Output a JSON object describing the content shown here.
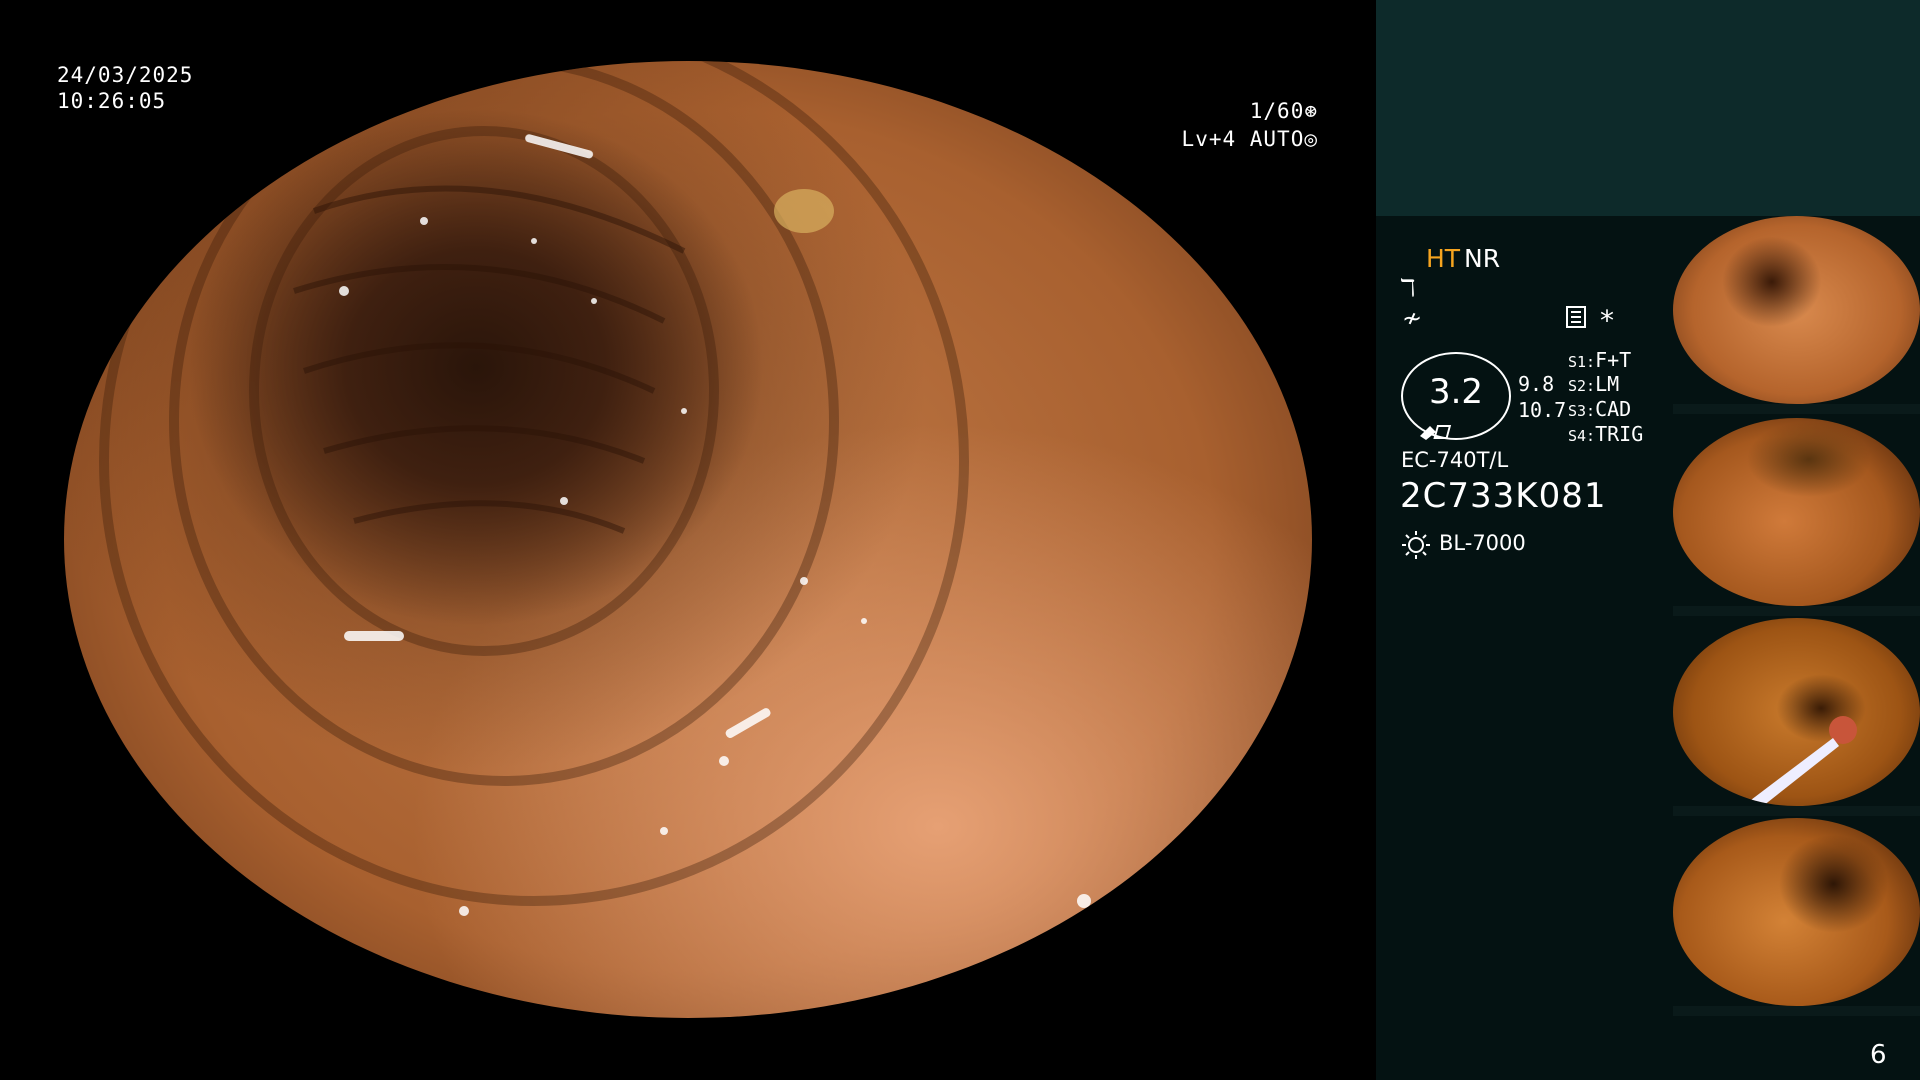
{
  "osd": {
    "date": "24/03/2025",
    "time": "10:26:05",
    "shutter": "1/60",
    "level": "Lv+4 AUTO"
  },
  "panel": {
    "ht": "HT",
    "nr": "NR",
    "zoom": "3.2",
    "value_a": "9.8",
    "value_b": "10.7",
    "settings": [
      {
        "key": "S1:",
        "value": "F+T"
      },
      {
        "key": "S2:",
        "value": "LM"
      },
      {
        "key": "S3:",
        "value": "CAD"
      },
      {
        "key": "S4:",
        "value": "TRIG"
      }
    ],
    "model": "EC-740T/L",
    "serial": "2C733K081",
    "light_source": "BL-7000",
    "asterisk": "*"
  },
  "colors": {
    "accent": "#f6a41f",
    "panel_top": "#0d2a2a",
    "panel": "#041212"
  },
  "page_number": "6"
}
